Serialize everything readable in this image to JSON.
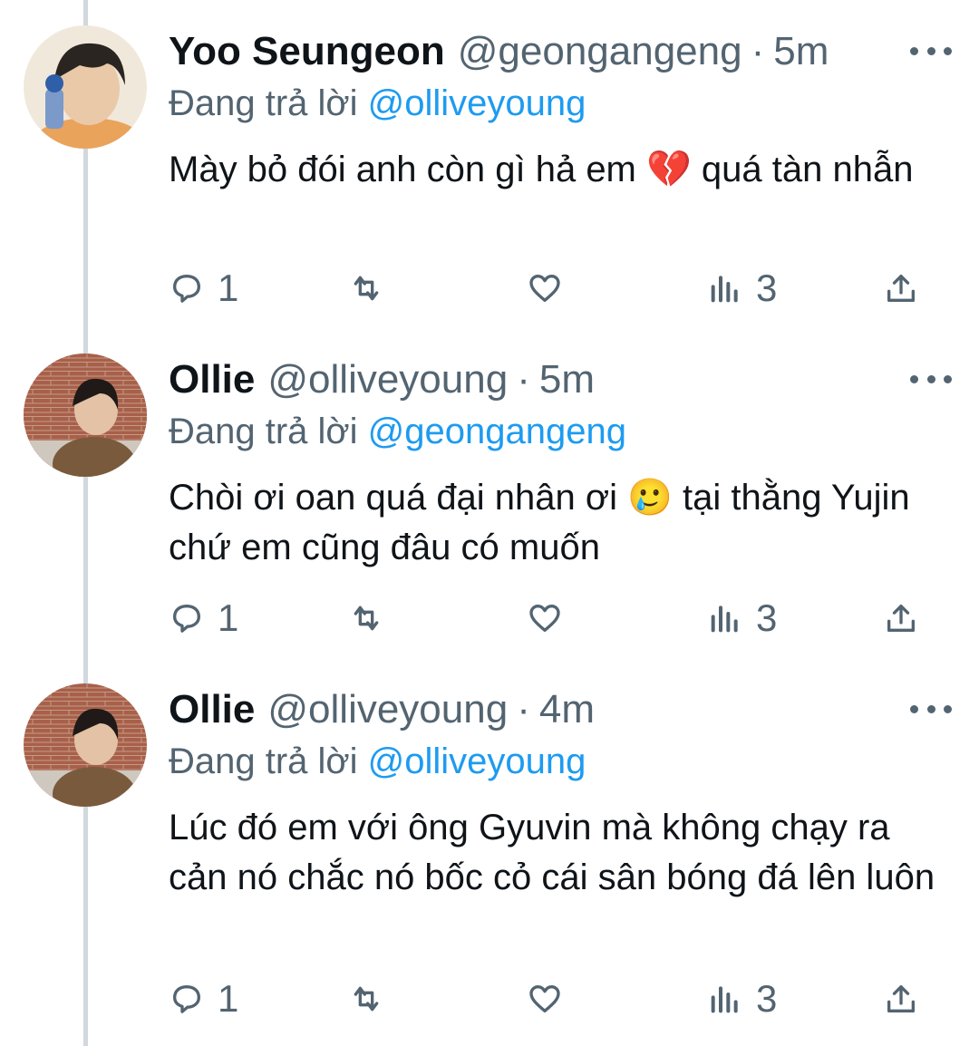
{
  "tweets": [
    {
      "name": "Yoo Seungeon",
      "handle": "@geongangeng",
      "time": "5m",
      "replying_prefix": "Đang trả lời",
      "replying_to": "@olliveyoung",
      "text": "Mày bỏ đói anh còn gì hả em 💔 quá tàn nhẫn",
      "replies": "1",
      "views": "3"
    },
    {
      "name": "Ollie",
      "handle": "@olliveyoung",
      "time": "5m",
      "replying_prefix": "Đang trả lời",
      "replying_to": "@geongangeng",
      "text": "Chòi ơi oan quá đại nhân ơi 🥲 tại thằng Yujin chứ em cũng đâu có muốn",
      "replies": "1",
      "views": "3"
    },
    {
      "name": "Ollie",
      "handle": "@olliveyoung",
      "time": "4m",
      "replying_prefix": "Đang trả lời",
      "replying_to": "@olliveyoung",
      "text": "Lúc đó em với ông Gyuvin mà không chạy ra cản nó chắc nó bốc cỏ cái sân bóng đá lên luôn",
      "replies": "1",
      "views": "3"
    }
  ],
  "dot": "·",
  "colors": {
    "mention": "#1d9bf0",
    "secondary": "#536471",
    "thread_line": "#cfd9de"
  }
}
